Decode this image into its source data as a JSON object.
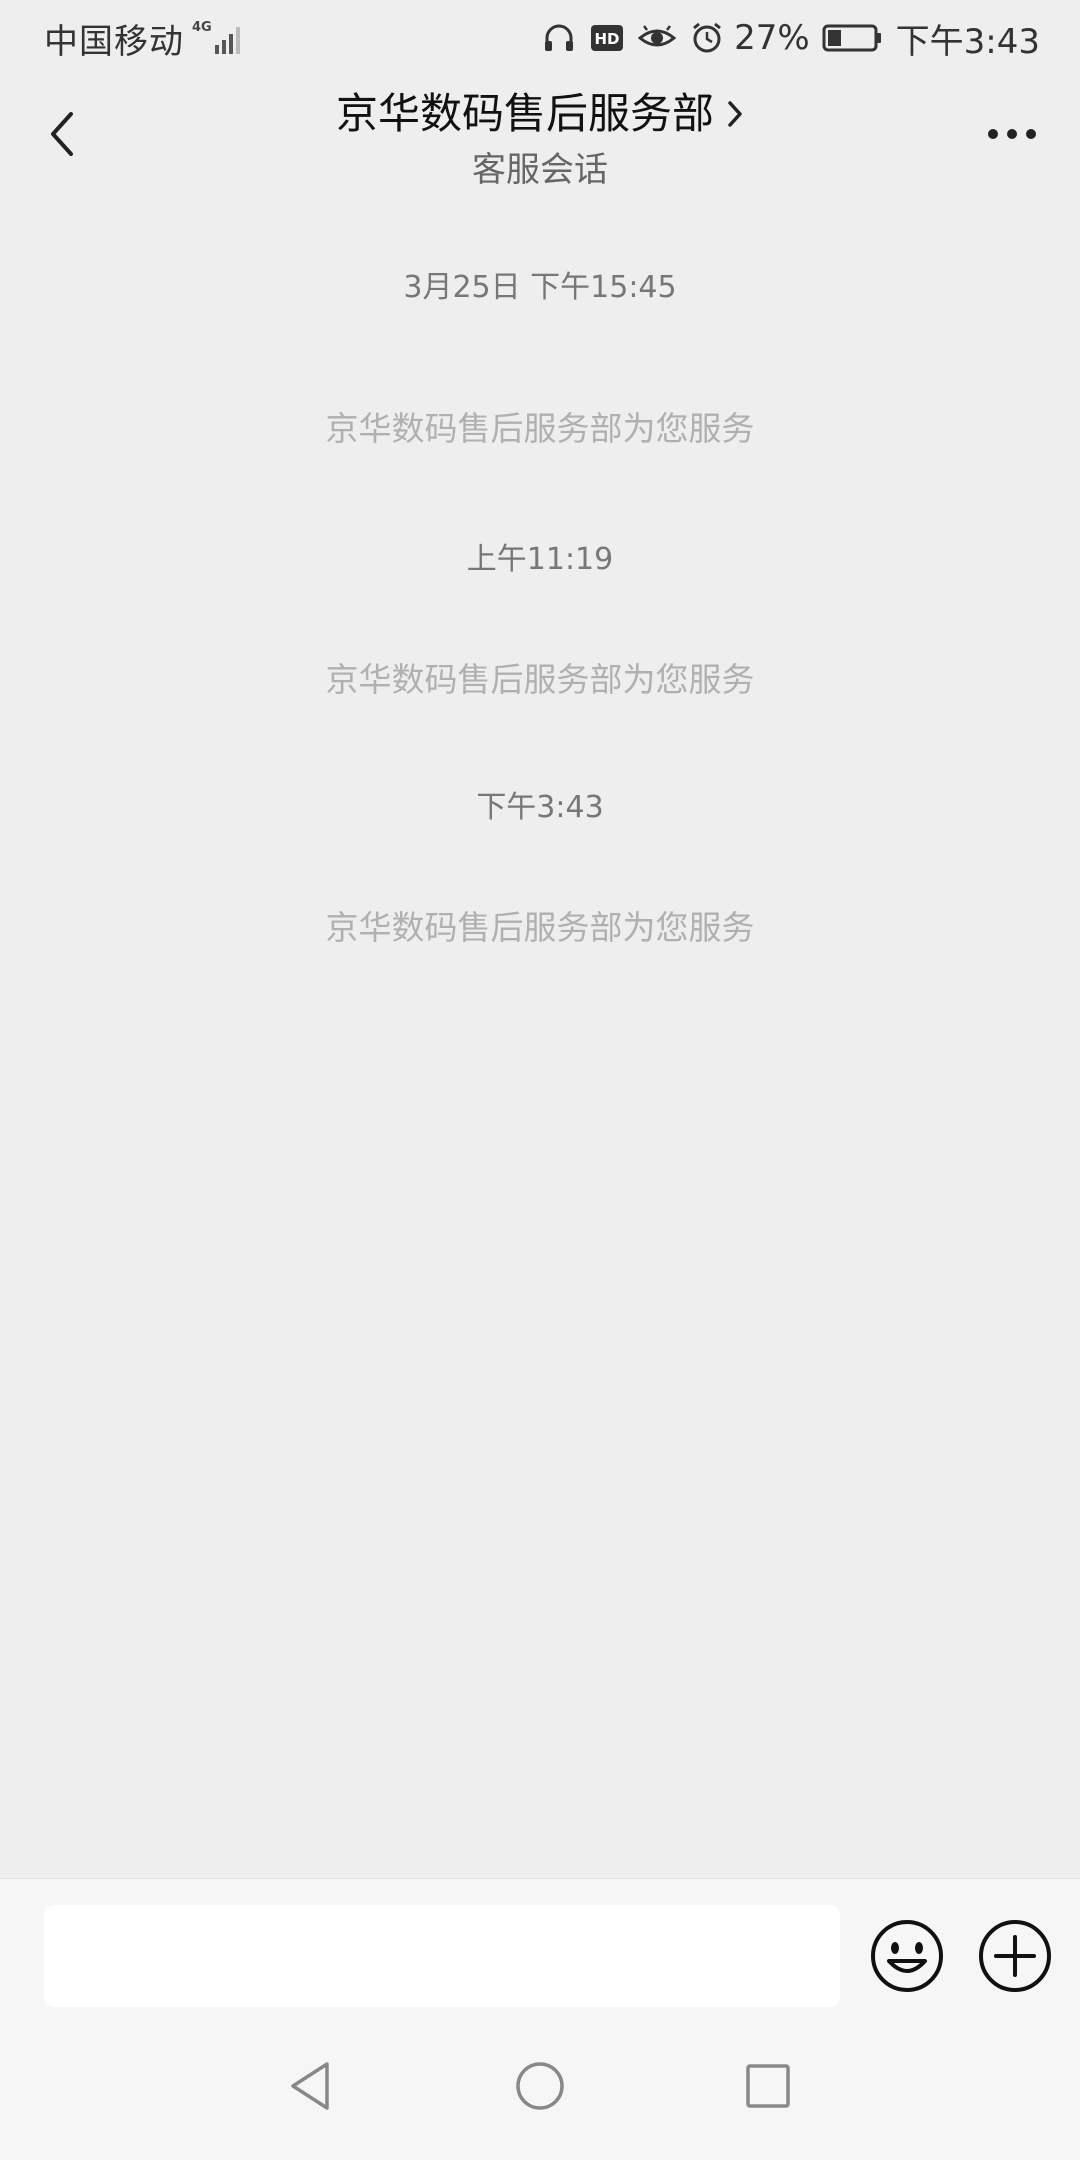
{
  "status_bar": {
    "carrier": "中国移动",
    "network_type": "4G",
    "battery_percent": "27%",
    "time": "下午3:43",
    "icons": [
      "signal-icon",
      "headphones-icon",
      "hd-icon",
      "eye-icon",
      "alarm-icon",
      "battery-icon"
    ]
  },
  "header": {
    "title": "京华数码售后服务部",
    "subtitle": "客服会话",
    "icons": [
      "back-arrow-icon",
      "chevron-right-icon",
      "more-dots-icon"
    ]
  },
  "messages": [
    {
      "timestamp": "3月25日 下午15:45",
      "text": "京华数码售后服务部为您服务"
    },
    {
      "timestamp": "上午11:19",
      "text": "京华数码售后服务部为您服务"
    },
    {
      "timestamp": "下午3:43",
      "text": "京华数码售后服务部为您服务"
    }
  ],
  "input_bar": {
    "value": "",
    "placeholder": "",
    "icons": [
      "emoji-icon",
      "plus-circle-icon"
    ]
  },
  "nav_bar": {
    "icons": [
      "nav-back-icon",
      "nav-home-icon",
      "nav-recent-icon"
    ]
  },
  "colors": {
    "background": "#eeeeee",
    "bar_background": "#f6f6f6",
    "system_text": "#b0b0b0",
    "timestamp_text": "#777777"
  }
}
